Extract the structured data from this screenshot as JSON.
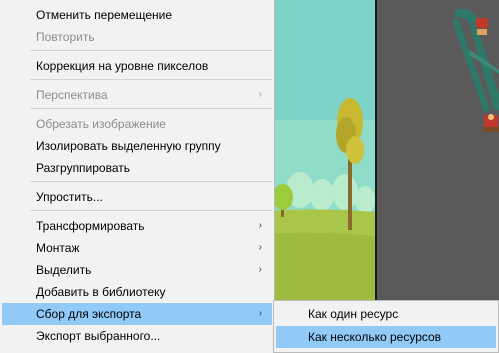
{
  "menu": {
    "items": [
      {
        "label": "Отменить перемещение",
        "enabled": true
      },
      {
        "label": "Повторить",
        "enabled": false
      },
      {
        "label": "Коррекция на уровне пикселов",
        "enabled": true
      },
      {
        "label": "Перспектива",
        "enabled": false,
        "submenu_arrow": "›"
      },
      {
        "label": "Обрезать изображение",
        "enabled": false
      },
      {
        "label": "Изолировать выделенную группу",
        "enabled": true
      },
      {
        "label": "Разгруппировать",
        "enabled": true
      },
      {
        "label": "Упростить...",
        "enabled": true
      },
      {
        "label": "Трансформировать",
        "enabled": true,
        "submenu_arrow": "›"
      },
      {
        "label": "Монтаж",
        "enabled": true,
        "submenu_arrow": "›"
      },
      {
        "label": "Выделить",
        "enabled": true,
        "submenu_arrow": "›"
      },
      {
        "label": "Добавить в библиотеку",
        "enabled": true
      },
      {
        "label": "Сбор для экспорта",
        "enabled": true,
        "submenu_arrow": "›",
        "highlighted": true
      },
      {
        "label": "Экспорт выбранного...",
        "enabled": true
      }
    ]
  },
  "submenu": {
    "items": [
      {
        "label": "Как один ресурс"
      },
      {
        "label": "Как несколько ресурсов",
        "highlighted": true
      }
    ]
  },
  "colors": {
    "menu_bg": "#f2f2f2",
    "highlight": "#91c9f7",
    "disabled_text": "#8d8d8d",
    "workspace": "#5a5a5a"
  }
}
